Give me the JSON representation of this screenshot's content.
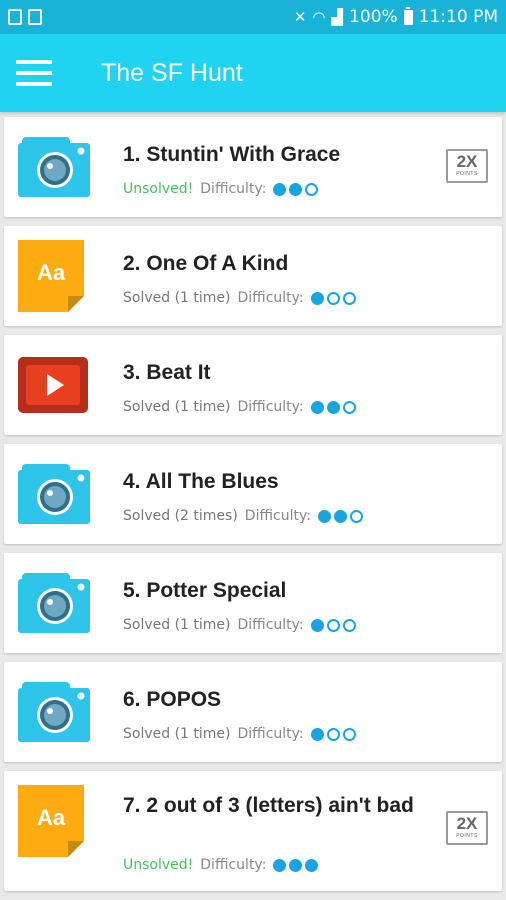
{
  "status_bar": {
    "left_icons": [
      "download-icon",
      "image-icon"
    ],
    "right_icons": [
      "mute-icon",
      "wifi-icon",
      "signal-icon",
      "battery-icon"
    ],
    "battery": "100%",
    "time": "11:10 PM"
  },
  "app_bar": {
    "title": "The SF Hunt"
  },
  "labels": {
    "difficulty": "Difficulty:"
  },
  "colors": {
    "accent": "#1fd3f1",
    "status_bar": "#1ab3d8",
    "unsolved": "#43c25c",
    "dot": "#1aa5e0"
  },
  "hunts": [
    {
      "title": "1. Stuntin' With Grace",
      "status": "Unsolved!",
      "solved": false,
      "difficulty": 2,
      "icon": "camera-icon",
      "badge": {
        "big": "2X",
        "small": "POINTS"
      }
    },
    {
      "title": "2. One Of A Kind",
      "status": "Solved (1 time)",
      "solved": true,
      "difficulty": 1,
      "icon": "text-icon",
      "badge": null
    },
    {
      "title": "3. Beat It",
      "status": "Solved (1 time)",
      "solved": true,
      "difficulty": 2,
      "icon": "video-icon",
      "badge": null
    },
    {
      "title": "4. All The Blues",
      "status": "Solved (2 times)",
      "solved": true,
      "difficulty": 2,
      "icon": "camera-icon",
      "badge": null
    },
    {
      "title": "5. Potter Special",
      "status": "Solved (1 time)",
      "solved": true,
      "difficulty": 1,
      "icon": "camera-icon",
      "badge": null
    },
    {
      "title": "6. POPOS",
      "status": "Solved (1 time)",
      "solved": true,
      "difficulty": 1,
      "icon": "camera-icon",
      "badge": null
    },
    {
      "title": "7. 2 out of 3 (letters) ain't bad",
      "status": "Unsolved!",
      "solved": false,
      "difficulty": 3,
      "icon": "text-icon",
      "badge": {
        "big": "2X",
        "small": "POINTS"
      }
    }
  ]
}
